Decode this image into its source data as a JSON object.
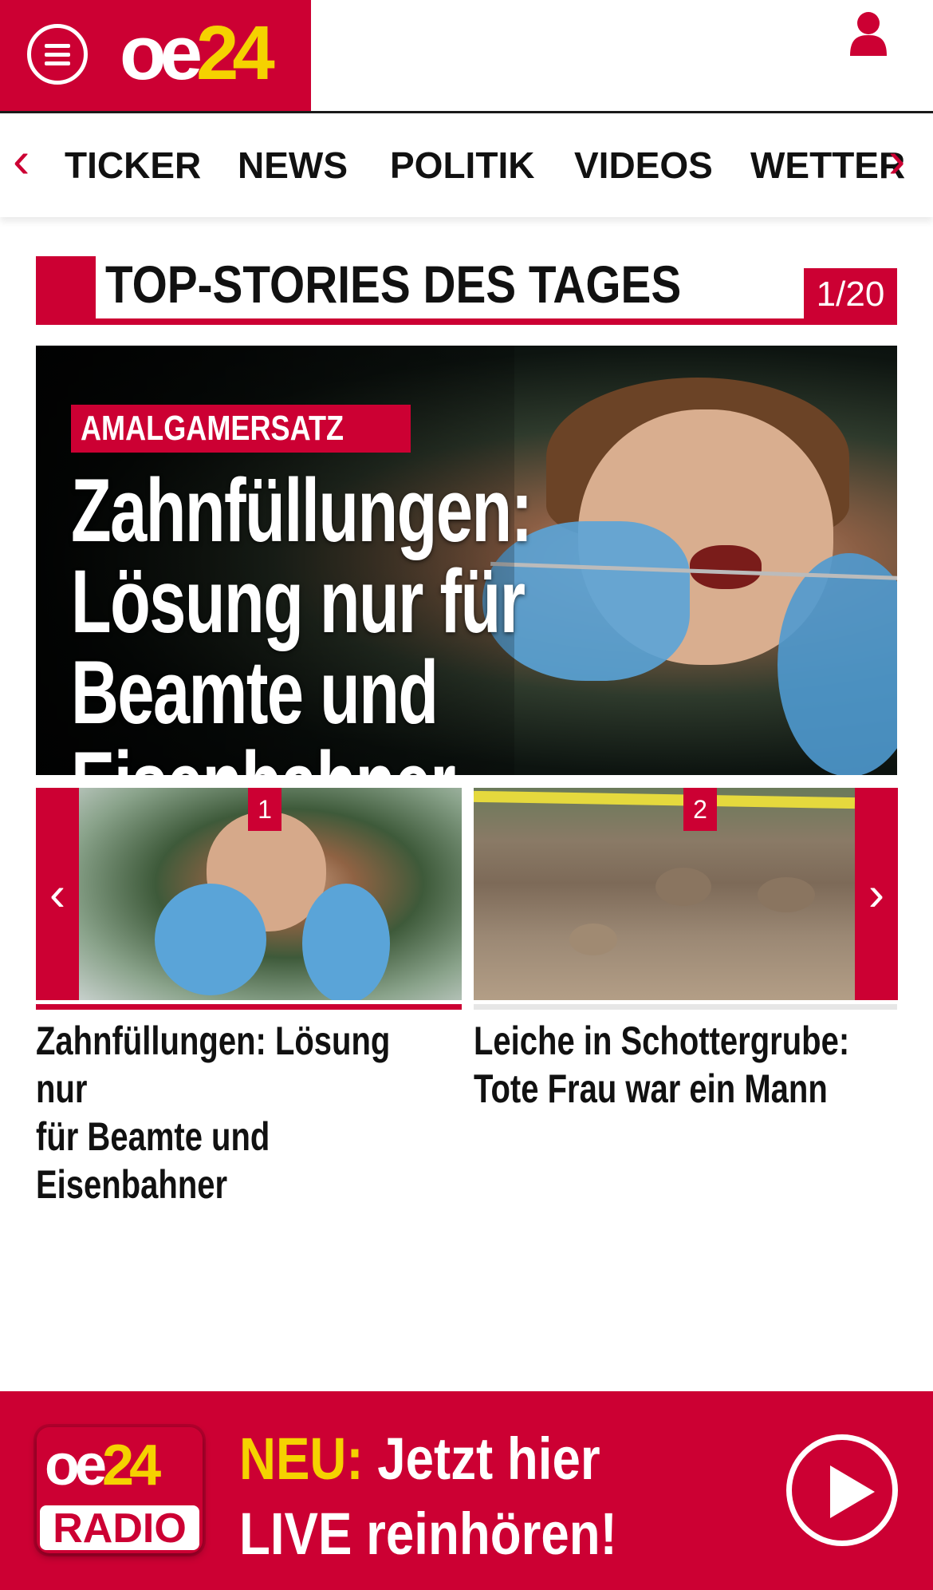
{
  "header": {
    "logo_oe": "oe",
    "logo_24": "24",
    "brand_color": "#cc0033",
    "accent_color": "#f5d200"
  },
  "nav": {
    "prev_icon": "‹",
    "next_icon": "›",
    "items": [
      "TICKER",
      "NEWS",
      "POLITIK",
      "VIDEOS",
      "WETTER"
    ]
  },
  "top_stories": {
    "title": "TOP-STORIES DES TAGES",
    "counter": "1/20"
  },
  "hero": {
    "kicker": "AMALGAMERSATZ",
    "line1": "Zahnfüllungen:",
    "line2": "Lösung nur für",
    "line3": "Beamte und Eisenbahner"
  },
  "carousel": {
    "prev_icon": "‹",
    "next_icon": "›",
    "items": [
      {
        "number": "1",
        "caption_line1": "Zahnfüllungen: Lösung nur",
        "caption_line2": "für Beamte und",
        "caption_line3": "Eisenbahner"
      },
      {
        "number": "2",
        "caption_line1": "Leiche in Schottergrube:",
        "caption_line2": "Tote Frau war ein Mann"
      }
    ]
  },
  "radio_banner": {
    "logo_oe": "oe",
    "logo_24": "24",
    "logo_radio": "RADIO",
    "neu": "NEU:",
    "line1_rest": " Jetzt hier",
    "line2": "LIVE reinhören!"
  }
}
